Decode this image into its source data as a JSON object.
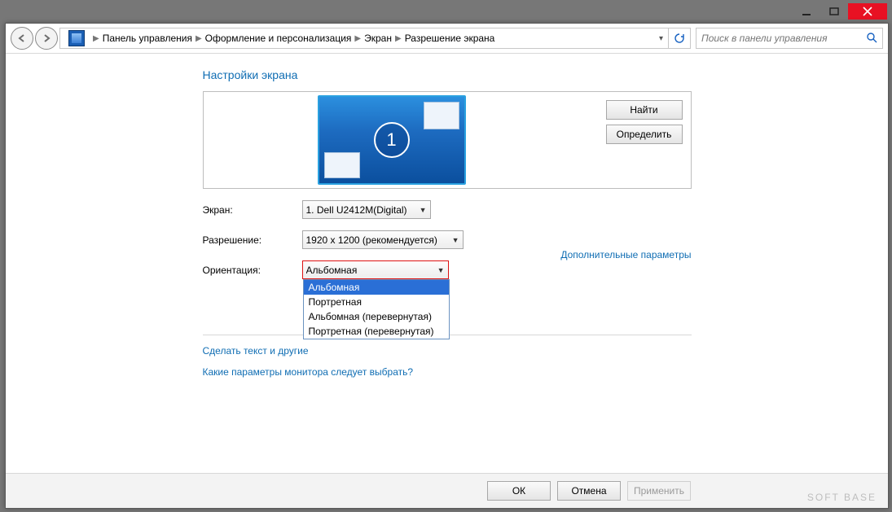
{
  "titlebar": {
    "close": "×"
  },
  "breadcrumbs": {
    "a": "Панель управления",
    "b": "Оформление и персонализация",
    "c": "Экран",
    "d": "Разрешение экрана"
  },
  "search": {
    "placeholder": "Поиск в панели управления"
  },
  "heading": "Настройки экрана",
  "monitor_badge": "1",
  "buttons": {
    "find": "Найти",
    "identify": "Определить",
    "ok": "ОК",
    "cancel": "Отмена",
    "apply": "Применить"
  },
  "labels": {
    "display": "Экран:",
    "resolution": "Разрешение:",
    "orientation": "Ориентация:"
  },
  "values": {
    "display": "1. Dell U2412M(Digital)",
    "resolution": "1920 x 1200 (рекомендуется)",
    "orientation": "Альбомная"
  },
  "orientation_options": {
    "o0": "Альбомная",
    "o1": "Портретная",
    "o2": "Альбомная (перевернутая)",
    "o3": "Портретная (перевернутая)"
  },
  "links": {
    "advanced": "Дополнительные параметры",
    "textsize": "Сделать текст и другие",
    "whichmon": "Какие параметры монитора следует выбрать?"
  },
  "watermark": "SOFT BASE"
}
